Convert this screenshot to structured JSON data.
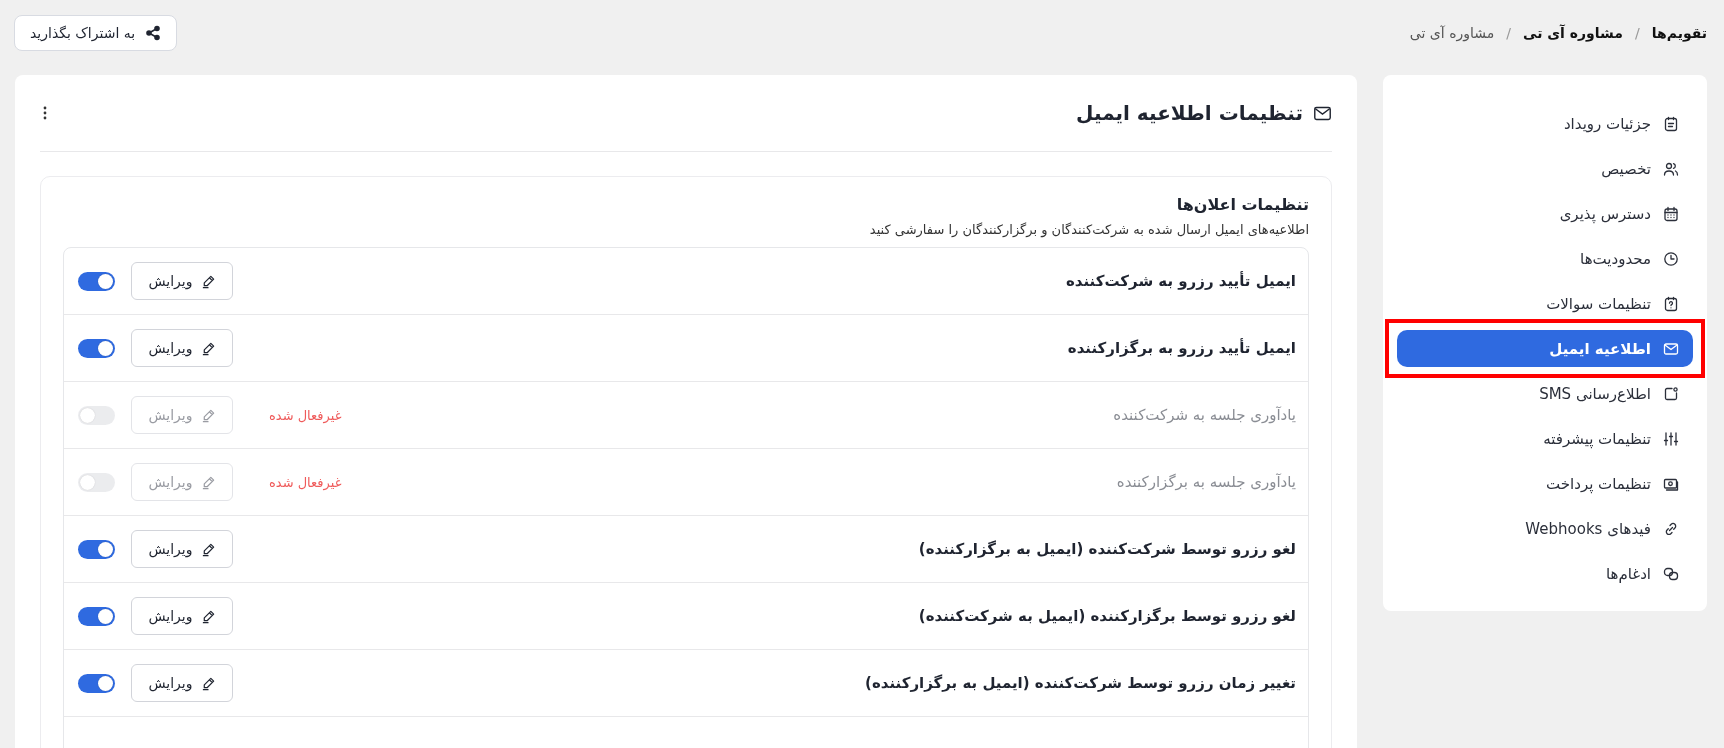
{
  "breadcrumb": {
    "separator": "/",
    "items": [
      {
        "label": "تقویم‌ها",
        "current": false
      },
      {
        "label": "مشاوره آی تی",
        "current": false
      },
      {
        "label": "مشاوره آی تی",
        "current": true
      }
    ]
  },
  "share_button": {
    "label": "به اشتراک بگذارید"
  },
  "sidebar": {
    "items": [
      {
        "label": "جزئیات رویداد",
        "selected": false
      },
      {
        "label": "تخصیص",
        "selected": false
      },
      {
        "label": "دسترس پذیری",
        "selected": false
      },
      {
        "label": "محدودیت‌ها",
        "selected": false
      },
      {
        "label": "تنظیمات سوالات",
        "selected": false
      },
      {
        "label": "اطلاعیه ایمیل",
        "selected": true
      },
      {
        "label": "اطلاع‌رسانی SMS",
        "selected": false
      },
      {
        "label": "تنظیمات پیشرفته",
        "selected": false
      },
      {
        "label": "تنظیمات پرداخت",
        "selected": false
      },
      {
        "label": "فیدهای Webhooks",
        "selected": false
      },
      {
        "label": "ادغام‌ها",
        "selected": false
      }
    ]
  },
  "panel": {
    "title": "تنظیمات اطلاعیه ایمیل",
    "section": {
      "title": "تنظیمات اعلان‌ها",
      "subtitle": "اطلاعیه‌های ایمیل ارسال شده به شرکت‌کنندگان و برگزارکنندگان را سفارشی کنید",
      "notifications": [
        {
          "label": "ایمیل تأیید رزرو به شرکت‌کننده",
          "enabled": true,
          "on": true,
          "edit_label": "ویرایش"
        },
        {
          "label": "ایمیل تأیید رزرو به برگزارکننده",
          "enabled": true,
          "on": true,
          "edit_label": "ویرایش"
        },
        {
          "label": "یادآوری جلسه به شرکت‌کننده",
          "enabled": false,
          "on": false,
          "edit_label": "ویرایش",
          "status": "غیرفعال شده"
        },
        {
          "label": "یادآوری جلسه به برگزارکننده",
          "enabled": false,
          "on": false,
          "edit_label": "ویرایش",
          "status": "غیرفعال شده"
        },
        {
          "label": "لغو رزرو توسط شرکت‌کننده (ایمیل به برگزارکننده)",
          "enabled": true,
          "on": true,
          "edit_label": "ویرایش"
        },
        {
          "label": "لغو رزرو توسط برگزارکننده (ایمیل به شرکت‌کننده)",
          "enabled": true,
          "on": true,
          "edit_label": "ویرایش"
        },
        {
          "label": "تغییر زمان رزرو توسط شرکت‌کننده (ایمیل به برگزارکننده)",
          "enabled": true,
          "on": true,
          "edit_label": "ویرایش"
        }
      ]
    }
  }
}
